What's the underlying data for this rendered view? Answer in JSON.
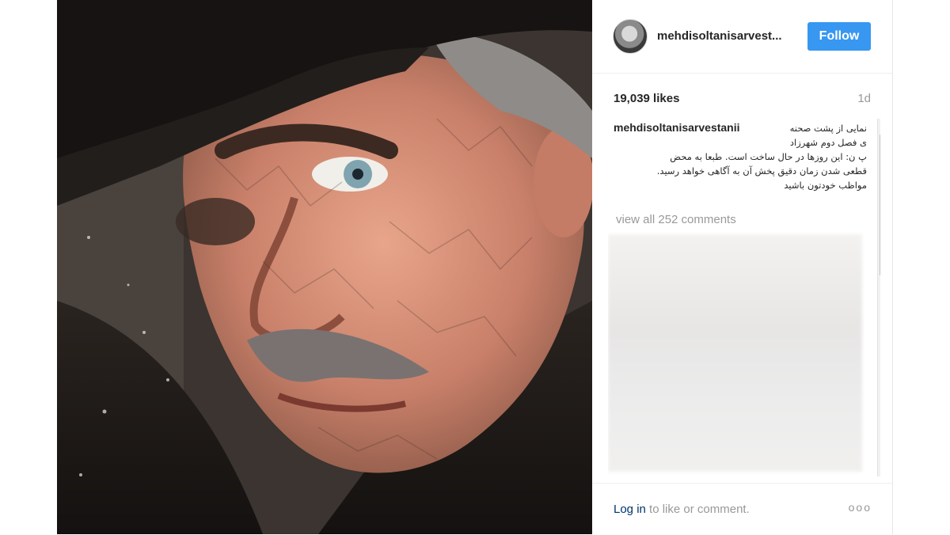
{
  "post": {
    "username": "mehdisoltanisarvest...",
    "follow_label": "Follow",
    "likes": "19,039 likes",
    "time": "1d",
    "caption_user": "mehdisoltanisarvestanii",
    "caption_text": "نمایی از پشت صحنه\nی فصل دوم شهرزاد\nپ ن: این روزها در حال ساخت است. طبعا به محض\nقطعی شدن زمان دقیق پخش آن به آگاهی خواهد رسید.\nمواظب خودتون باشید",
    "view_all": "view all 252 comments",
    "login_link": "Log in",
    "login_rest": " to like or comment.",
    "more_icon": "ooo"
  },
  "colors": {
    "follow_bg": "#3897f0",
    "link": "#003569",
    "muted": "#999999"
  }
}
